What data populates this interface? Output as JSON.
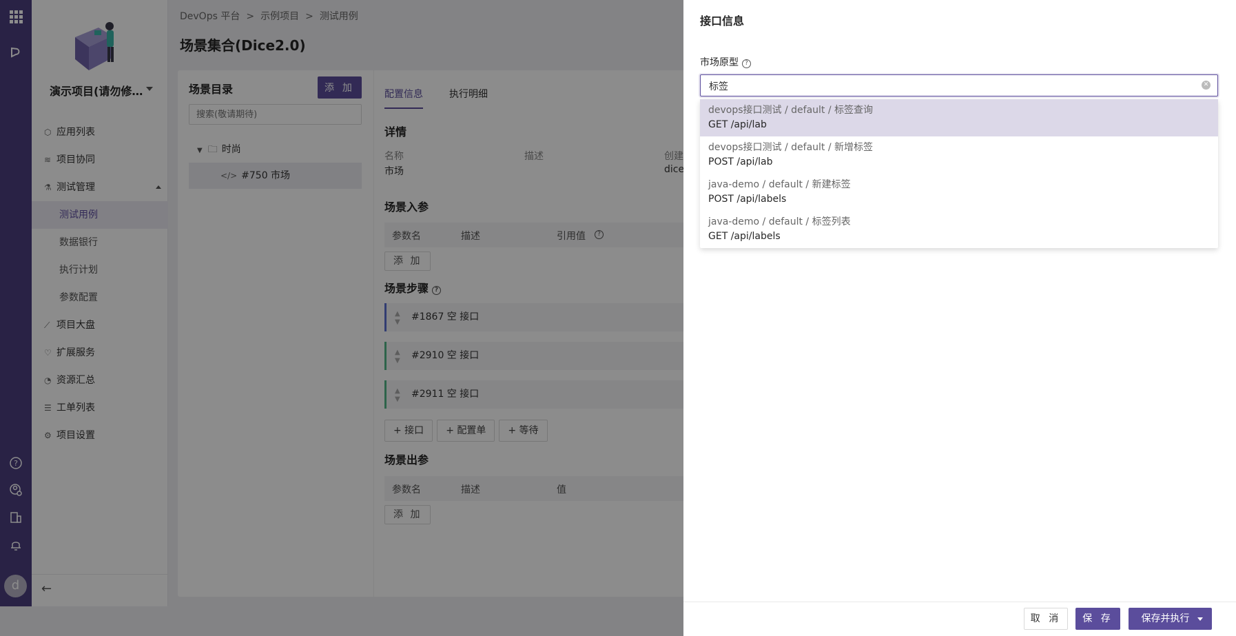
{
  "rail": {
    "icons": [
      "apps-grid-icon",
      "platform-logo-icon",
      "help-icon",
      "user-settings-icon",
      "org-icon",
      "bell-icon"
    ],
    "avatar_letter": "d"
  },
  "sidebar": {
    "project_name": "演示项目(请勿修…",
    "items": [
      {
        "label": "应用列表"
      },
      {
        "label": "项目协同"
      },
      {
        "label": "测试管理"
      },
      {
        "label": "测试用例"
      },
      {
        "label": "数据银行"
      },
      {
        "label": "执行计划"
      },
      {
        "label": "参数配置"
      },
      {
        "label": "项目大盘"
      },
      {
        "label": "扩展服务"
      },
      {
        "label": "资源汇总"
      },
      {
        "label": "工单列表"
      },
      {
        "label": "项目设置"
      }
    ],
    "collapse_label": "←"
  },
  "breadcrumb": [
    "DevOps 平台",
    ">",
    "示例项目",
    ">",
    "测试用例"
  ],
  "page_title": "场景集合(Dice2.0)",
  "scene_tree": {
    "title": "场景目录",
    "add_label": "添 加",
    "search_placeholder": "搜索(敬请期待)",
    "folder": "时尚",
    "leaf": "#750 市场"
  },
  "config": {
    "tabs": [
      "配置信息",
      "执行明细"
    ],
    "details_title": "详情",
    "name_label": "名称",
    "desc_label": "描述",
    "created_label": "创建",
    "name_value": "市场",
    "created_value": "dice",
    "inputs_title": "场景入参",
    "inputs_cols": [
      "参数名",
      "描述",
      "引用值"
    ],
    "add_label": "添 加",
    "steps_title": "场景步骤",
    "steps": [
      "#1867 空 接口",
      "#2910 空 接口",
      "#2911 空 接口"
    ],
    "add_step_buttons": [
      "+ 接口",
      "+ 配置单",
      "+ 等待"
    ],
    "outputs_title": "场景出参",
    "outputs_cols": [
      "参数名",
      "描述",
      "值"
    ]
  },
  "drawer": {
    "title": "接口信息",
    "field_label": "市场原型",
    "select_value": "标签",
    "options": [
      {
        "path": "devops接口测试 / default / 标签查询",
        "method": "GET /api/lab"
      },
      {
        "path": "devops接口测试 / default / 新增标签",
        "method": "POST /api/lab"
      },
      {
        "path": "java-demo / default / 新建标签",
        "method": "POST /api/labels"
      },
      {
        "path": "java-demo / default / 标签列表",
        "method": "GET /api/labels"
      }
    ],
    "cancel_label": "取 消",
    "save_label": "保 存",
    "save_exec_label": "保存并执行"
  },
  "colors": {
    "rail": "#4b3f7f",
    "primary": "#5b4d9c",
    "highlight_option": "#dcd8e8"
  }
}
